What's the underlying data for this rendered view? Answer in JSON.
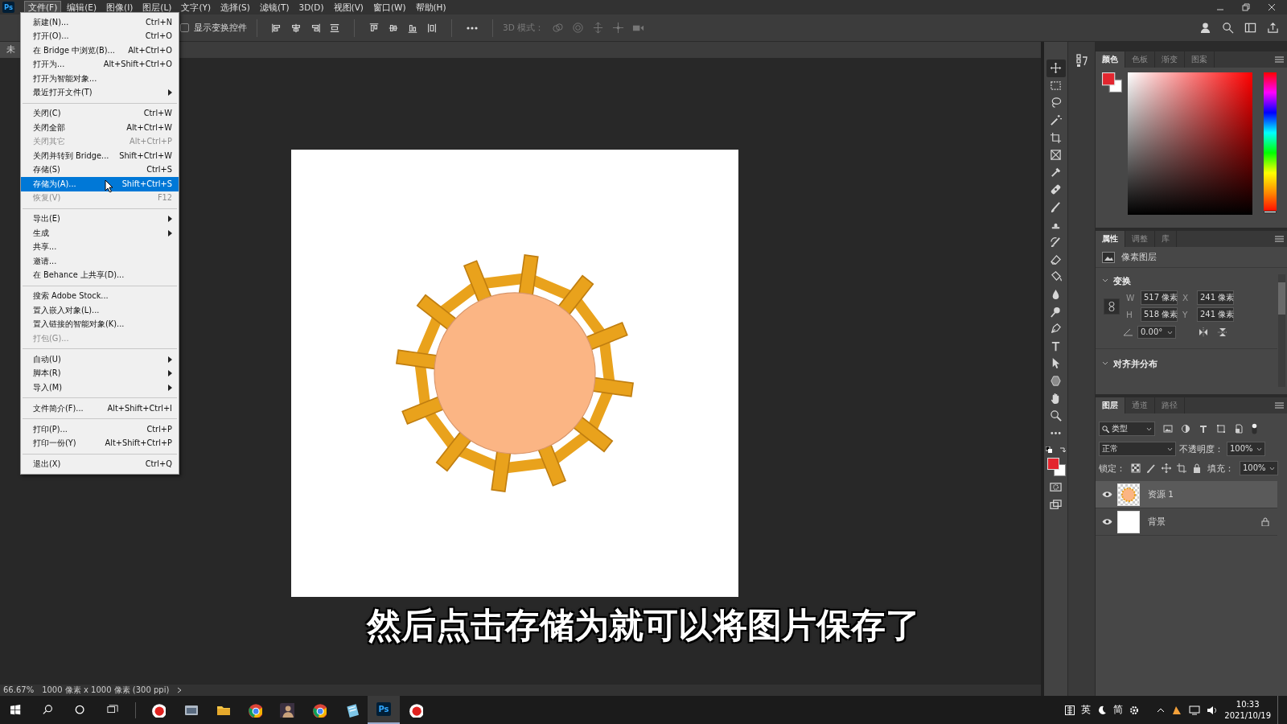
{
  "app_logo": "Ps",
  "menu_bar": [
    {
      "label": "文件(F)",
      "selected": true
    },
    {
      "label": "编辑(E)",
      "selected": false
    },
    {
      "label": "图像(I)",
      "selected": false
    },
    {
      "label": "图层(L)",
      "selected": false
    },
    {
      "label": "文字(Y)",
      "selected": false
    },
    {
      "label": "选择(S)",
      "selected": false
    },
    {
      "label": "滤镜(T)",
      "selected": false
    },
    {
      "label": "3D(D)",
      "selected": false
    },
    {
      "label": "视图(V)",
      "selected": false
    },
    {
      "label": "窗口(W)",
      "selected": false
    },
    {
      "label": "帮助(H)",
      "selected": false
    }
  ],
  "options_bar": {
    "show_transform_controls": {
      "label": "显示变换控件",
      "checked": false
    },
    "mode_3d_label": "3D 模式："
  },
  "document_tab": "未",
  "file_menu": [
    {
      "kind": "item",
      "label": "新建(N)...",
      "shortcut": "Ctrl+N",
      "disabled": false,
      "submenu": false,
      "selected": false
    },
    {
      "kind": "item",
      "label": "打开(O)...",
      "shortcut": "Ctrl+O",
      "disabled": false,
      "submenu": false,
      "selected": false
    },
    {
      "kind": "item",
      "label": "在 Bridge 中浏览(B)...",
      "shortcut": "Alt+Ctrl+O",
      "disabled": false,
      "submenu": false,
      "selected": false
    },
    {
      "kind": "item",
      "label": "打开为...",
      "shortcut": "Alt+Shift+Ctrl+O",
      "disabled": false,
      "submenu": false,
      "selected": false
    },
    {
      "kind": "item",
      "label": "打开为智能对象...",
      "disabled": false,
      "submenu": false,
      "selected": false
    },
    {
      "kind": "item",
      "label": "最近打开文件(T)",
      "disabled": false,
      "submenu": true,
      "selected": false
    },
    {
      "kind": "separator"
    },
    {
      "kind": "item",
      "label": "关闭(C)",
      "shortcut": "Ctrl+W",
      "disabled": false,
      "submenu": false,
      "selected": false
    },
    {
      "kind": "item",
      "label": "关闭全部",
      "shortcut": "Alt+Ctrl+W",
      "disabled": false,
      "submenu": false,
      "selected": false
    },
    {
      "kind": "item",
      "label": "关闭其它",
      "shortcut": "Alt+Ctrl+P",
      "disabled": true,
      "submenu": false,
      "selected": false
    },
    {
      "kind": "item",
      "label": "关闭并转到 Bridge...",
      "shortcut": "Shift+Ctrl+W",
      "disabled": false,
      "submenu": false,
      "selected": false
    },
    {
      "kind": "item",
      "label": "存储(S)",
      "shortcut": "Ctrl+S",
      "disabled": false,
      "submenu": false,
      "selected": false
    },
    {
      "kind": "item",
      "label": "存储为(A)...",
      "shortcut": "Shift+Ctrl+S",
      "disabled": false,
      "submenu": false,
      "selected": true
    },
    {
      "kind": "item",
      "label": "恢复(V)",
      "shortcut": "F12",
      "disabled": true,
      "submenu": false,
      "selected": false
    },
    {
      "kind": "separator"
    },
    {
      "kind": "item",
      "label": "导出(E)",
      "disabled": false,
      "submenu": true,
      "selected": false
    },
    {
      "kind": "item",
      "label": "生成",
      "disabled": false,
      "submenu": true,
      "selected": false
    },
    {
      "kind": "item",
      "label": "共享...",
      "disabled": false,
      "submenu": false,
      "selected": false
    },
    {
      "kind": "item",
      "label": "邀请...",
      "disabled": false,
      "submenu": false,
      "selected": false
    },
    {
      "kind": "item",
      "label": "在 Behance 上共享(D)...",
      "disabled": false,
      "submenu": false,
      "selected": false
    },
    {
      "kind": "separator"
    },
    {
      "kind": "item",
      "label": "搜索 Adobe Stock...",
      "disabled": false,
      "submenu": false,
      "selected": false
    },
    {
      "kind": "item",
      "label": "置入嵌入对象(L)...",
      "disabled": false,
      "submenu": false,
      "selected": false
    },
    {
      "kind": "item",
      "label": "置入链接的智能对象(K)...",
      "disabled": false,
      "submenu": false,
      "selected": false
    },
    {
      "kind": "item",
      "label": "打包(G)...",
      "disabled": true,
      "submenu": false,
      "selected": false
    },
    {
      "kind": "separator"
    },
    {
      "kind": "item",
      "label": "自动(U)",
      "disabled": false,
      "submenu": true,
      "selected": false
    },
    {
      "kind": "item",
      "label": "脚本(R)",
      "disabled": false,
      "submenu": true,
      "selected": false
    },
    {
      "kind": "item",
      "label": "导入(M)",
      "disabled": false,
      "submenu": true,
      "selected": false
    },
    {
      "kind": "separator"
    },
    {
      "kind": "item",
      "label": "文件简介(F)...",
      "shortcut": "Alt+Shift+Ctrl+I",
      "disabled": false,
      "submenu": false,
      "selected": false
    },
    {
      "kind": "separator"
    },
    {
      "kind": "item",
      "label": "打印(P)...",
      "shortcut": "Ctrl+P",
      "disabled": false,
      "submenu": false,
      "selected": false
    },
    {
      "kind": "item",
      "label": "打印一份(Y)",
      "shortcut": "Alt+Shift+Ctrl+P",
      "disabled": false,
      "submenu": false,
      "selected": false
    },
    {
      "kind": "separator"
    },
    {
      "kind": "item",
      "label": "退出(X)",
      "shortcut": "Ctrl+Q",
      "disabled": false,
      "submenu": false,
      "selected": false
    }
  ],
  "subtitle": "然后点击存储为就可以将图片保存了",
  "color_panel": {
    "tabs": [
      {
        "label": "颜色",
        "selected": true
      },
      {
        "label": "色板",
        "selected": false
      },
      {
        "label": "渐变",
        "selected": false
      },
      {
        "label": "图案",
        "selected": false
      }
    ],
    "hue_slider": {
      "level": 0
    }
  },
  "properties_panel": {
    "tabs": [
      {
        "label": "属性",
        "selected": true
      },
      {
        "label": "调整",
        "selected": false
      },
      {
        "label": "库",
        "selected": false
      }
    ],
    "layer_type": "像素图层",
    "transform_title": "变换",
    "fields": [
      {
        "label": "W",
        "value": "517 像素"
      },
      {
        "label": "X",
        "value": "241 像素"
      },
      {
        "label": "H",
        "value": "518 像素"
      },
      {
        "label": "Y",
        "value": "241 像素"
      }
    ],
    "angle": "0.00°",
    "align_title": "对齐并分布"
  },
  "layers_panel": {
    "tabs": [
      {
        "label": "图层",
        "selected": true
      },
      {
        "label": "通道",
        "selected": false
      },
      {
        "label": "路径",
        "selected": false
      }
    ],
    "filter": "类型",
    "blend_mode": "正常",
    "opacity_label": "不透明度：",
    "opacity": "100%",
    "lock_label": "锁定：",
    "fill_label": "填充：",
    "fill": "100%",
    "layers": [
      {
        "name": "资源 1",
        "kind": "artwork",
        "visible": true,
        "selected": true,
        "locked": false
      },
      {
        "name": "背景",
        "kind": "white",
        "visible": true,
        "selected": false,
        "locked": true
      }
    ]
  },
  "status_bar": {
    "zoom": "66.67%",
    "doc_info": "1000 像素 x 1000 像素 (300 ppi)"
  },
  "taskbar": {
    "ps_label": "Ps",
    "ime": "英",
    "ime_mode": "简",
    "time": "10:33",
    "date": "2021/10/19"
  }
}
